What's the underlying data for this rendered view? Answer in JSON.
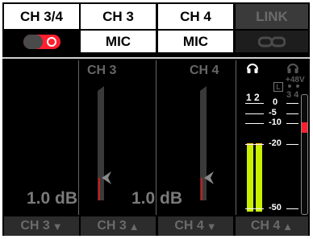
{
  "tabs": [
    {
      "label": "CH 3/4"
    },
    {
      "label": "CH 3"
    },
    {
      "label": "CH 4"
    },
    {
      "label": "LINK"
    }
  ],
  "inputs": {
    "ch3_mode": "MIC",
    "ch4_mode": "MIC",
    "stereo_toggle_on": true
  },
  "channels": [
    {
      "label": "CH 3",
      "gain_text": "1.0 dB"
    },
    {
      "label": "CH 4",
      "gain_text": "1.0 dB"
    }
  ],
  "meter": {
    "channel_nums": "1 2",
    "phantom_label": "+48V",
    "phantom_nums": "3 4",
    "l_marker": "L",
    "scale": [
      "0",
      "-5",
      "-10",
      "-20",
      "-50"
    ],
    "level_db": -20
  },
  "bottom_buttons": [
    {
      "label": "CH 3",
      "arrow": "▼"
    },
    {
      "label": "CH 3",
      "arrow": "▲"
    },
    {
      "label": "CH 4",
      "arrow": "▼"
    },
    {
      "label": "CH 4",
      "arrow": "▲"
    }
  ],
  "colors": {
    "accent_red": "#ff1f2e",
    "meter_green": "#c8f000",
    "peak_yellow": "#f2c318"
  },
  "icons": [
    "headphones-icon",
    "link-icon",
    "triangle-down-icon",
    "triangle-up-icon",
    "pointer-icon"
  ]
}
